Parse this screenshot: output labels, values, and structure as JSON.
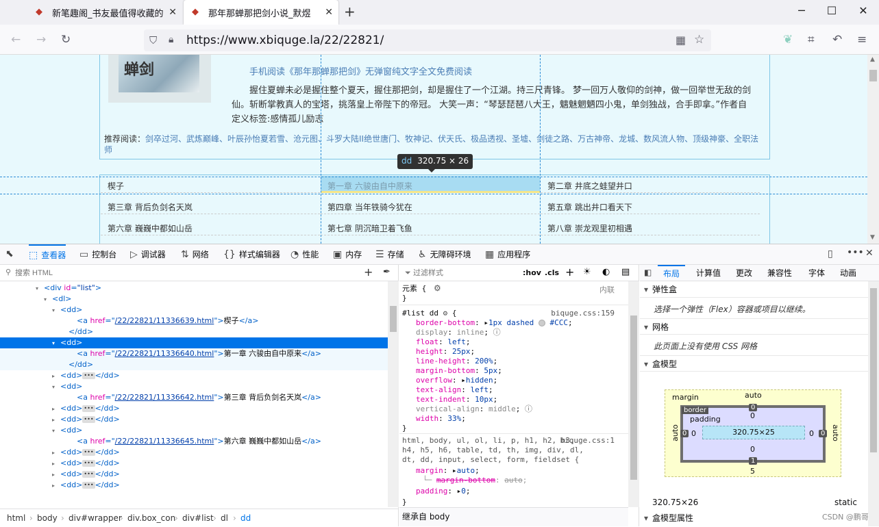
{
  "browser": {
    "tabs": [
      {
        "title": "新笔趣阁_书友最值得收藏的",
        "active": false
      },
      {
        "title": "那年那蝉那把剑小说_默煜",
        "active": true
      }
    ],
    "new_tab": "+",
    "url": "https://www.xbiquge.la/22/22821/"
  },
  "page": {
    "cover_text": "蝉剑",
    "mobile_link": "手机阅读《那年那蝉那把剑》无弹窗纯文字全文免费阅读",
    "intro": "握住夏蝉未必是握住整个夏天，握住那把剑，却是握住了一个江湖。持三尺青锋。 梦一回万人敬仰的剑神，做一回举世无敌的剑仙。斩断掌教真人的宝塔，挑落皇上帝陛下的帝冠。 大笑一声：“琴瑟琵琶八大王，魑魅魍魉四小鬼，单剑独战，合手即拿。”作者自定义标签:感情孤儿励志",
    "recommend_label": "推荐阅读：",
    "recommend": "剑卒过河、武炼巅峰、叶辰孙怡夏若雪、沧元图、斗罗大陆II绝世唐门、牧神记、伏天氏、极品透视、圣墟、剑徒之路、万古神帝、龙城、数风流人物、顶级神豪、全职法师",
    "chapters": [
      "楔子",
      "第一章 六骏由自中原来",
      "第二章 井底之蛙望井口",
      "第三章 背后负剑名天岚",
      "第四章 当年铁骑今犹在",
      "第五章 跳出井口看天下",
      "第六章 巍巍中都如山岳",
      "第七章 阴沉暗卫着飞鱼",
      "第八章 崇龙观里初相遇"
    ],
    "tooltip": {
      "tag": "dd",
      "size": "320.75 × 26"
    }
  },
  "devtools": {
    "tabs": [
      {
        "icon": "⬚",
        "label": "查看器",
        "active": true
      },
      {
        "icon": "▭",
        "label": "控制台"
      },
      {
        "icon": "▷",
        "label": "调试器"
      },
      {
        "icon": "⇅",
        "label": "网络"
      },
      {
        "icon": "{}",
        "label": "样式编辑器"
      },
      {
        "icon": "◔",
        "label": "性能"
      },
      {
        "icon": "▣",
        "label": "内存"
      },
      {
        "icon": "☰",
        "label": "存储"
      },
      {
        "icon": "♿",
        "label": "无障碍环境"
      },
      {
        "icon": "▦",
        "label": "应用程序"
      }
    ],
    "search_placeholder": "搜索 HTML",
    "tree": [
      {
        "indent": 4,
        "tw": "▾",
        "html": [
          "<",
          "div",
          " id=",
          "\"list\"",
          ">"
        ]
      },
      {
        "indent": 5,
        "tw": "▾",
        "text": "<dl>"
      },
      {
        "indent": 6,
        "tw": "▾",
        "text": "<dd>"
      },
      {
        "indent": 8,
        "tw": "",
        "href": "/22/22821/11336639.html",
        "link": "楔子"
      },
      {
        "indent": 7,
        "tw": "",
        "text": "</dd>"
      },
      {
        "indent": 6,
        "tw": "▾",
        "text": "<dd>",
        "sel": true
      },
      {
        "indent": 8,
        "tw": "",
        "href": "/22/22821/11336640.html",
        "link": "第一章 六骏由自中原来",
        "hl": true
      },
      {
        "indent": 7,
        "tw": "",
        "text": "</dd>",
        "hl": true
      },
      {
        "indent": 6,
        "tw": "▸",
        "collapsed": true
      },
      {
        "indent": 6,
        "tw": "▾",
        "text": "<dd>"
      },
      {
        "indent": 8,
        "tw": "",
        "href": "/22/22821/11336642.html",
        "link": "第三章 背后负剑名天岚"
      },
      {
        "indent": 6,
        "tw": "▸",
        "collapsed": true
      },
      {
        "indent": 6,
        "tw": "▸",
        "collapsed": true
      },
      {
        "indent": 6,
        "tw": "▾",
        "text": "<dd>"
      },
      {
        "indent": 8,
        "tw": "",
        "href": "/22/22821/11336645.html",
        "link": "第六章 巍巍中都如山岳"
      },
      {
        "indent": 6,
        "tw": "▸",
        "collapsed": true
      },
      {
        "indent": 6,
        "tw": "▸",
        "collapsed": true
      },
      {
        "indent": 6,
        "tw": "▸",
        "collapsed": true
      },
      {
        "indent": 6,
        "tw": "▸",
        "collapsed": true
      }
    ],
    "breadcrumbs": [
      "html",
      "body",
      "div#wrapper",
      "div.box_con",
      "div#list",
      "dl",
      "dd"
    ],
    "rules": {
      "filter_placeholder": "过滤样式",
      "hov": ":hov",
      "cls": ".cls",
      "element_rule": "元素 {",
      "inline": "内联",
      "list_dd_selector": "#list dd",
      "list_dd_source": "biquge.css:159",
      "list_dd_props": [
        {
          "n": "border-bottom",
          "v": "1px dashed",
          "color": "#CCC"
        },
        {
          "n": "display",
          "v": "inline",
          "inactive": true
        },
        {
          "n": "float",
          "v": "left"
        },
        {
          "n": "height",
          "v": "25px"
        },
        {
          "n": "line-height",
          "v": "200%"
        },
        {
          "n": "margin-bottom",
          "v": "5px"
        },
        {
          "n": "overflow",
          "v": "hidden"
        },
        {
          "n": "text-align",
          "v": "left"
        },
        {
          "n": "text-indent",
          "v": "10px"
        },
        {
          "n": "vertical-align",
          "v": "middle",
          "inactive": true
        },
        {
          "n": "width",
          "v": "33%"
        }
      ],
      "reset_selector_1": "html, body, ul, ol, li, p, h1, h2, h3,",
      "reset_selector_2": "h4, h5, h6, table, td, th, img, div, dl,",
      "reset_selector_3": "dt, dd, input, select, form, fieldset {",
      "reset_source": "biquge.css:1",
      "margin": "auto",
      "margin_bottom": "auto",
      "padding": "0",
      "inherited": "继承自 body"
    },
    "layout_tabs": [
      "布局",
      "计算值",
      "更改",
      "兼容性",
      "字体",
      "动画"
    ],
    "flexbox_title": "弹性盒",
    "flexbox_note": "选择一个弹性（Flex）容器或项目以继续。",
    "grid_title": "网格",
    "grid_note": "此页面上没有使用 CSS 网格",
    "boxmodel_title": "盒模型",
    "boxmodel": {
      "margin_label": "margin",
      "margin_top": "auto",
      "margin_bottom": "5",
      "margin_left": "auto",
      "margin_right": "auto",
      "border_label": "border",
      "border_top": "0",
      "border_bottom": "1",
      "border_left": "0",
      "border_right": "0",
      "padding_label": "padding",
      "padding_top": "0",
      "padding_bottom": "0",
      "padding_left": "0",
      "padding_right": "0",
      "content": "320.75×25",
      "dims": "320.75×26",
      "position": "static"
    },
    "boxmodel_props": "盒模型属性",
    "watermark": "CSDN @鹏哥"
  }
}
